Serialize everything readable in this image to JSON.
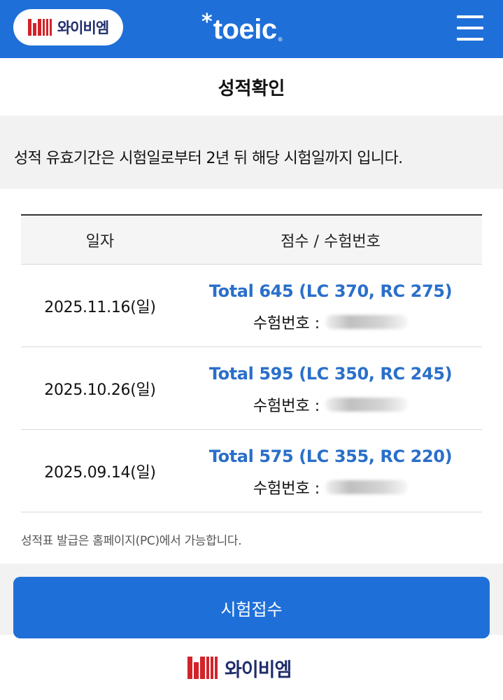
{
  "header": {
    "brand_pill_text": "와이비엠",
    "logo_text": "toeic",
    "logo_star": "*",
    "logo_reg": "®",
    "menu_icon": "hamburger-menu-icon",
    "background_color": "#1f6fd8"
  },
  "page": {
    "title": "성적확인",
    "notice": "성적 유효기간은 시험일로부터 2년 뒤 해당 시험일까지 입니다."
  },
  "score_table": {
    "columns": [
      "일자",
      "점수 / 수험번호"
    ],
    "rows": [
      {
        "date": "2025.11.16(일)",
        "total": "Total 645 (LC 370, RC 275)",
        "exam_label": "수험번호 :"
      },
      {
        "date": "2025.10.26(일)",
        "total": "Total 595 (LC 350, RC 245)",
        "exam_label": "수험번호 :"
      },
      {
        "date": "2025.09.14(일)",
        "total": "Total 575 (LC 355, RC 220)",
        "exam_label": "수험번호 :"
      }
    ],
    "score_color": "#2a6fc9"
  },
  "footnote": "성적표 발급은 홈페이지(PC)에서 가능합니다.",
  "cta": {
    "label": "시험접수"
  },
  "footer": {
    "brand_text": "와이비엠"
  }
}
